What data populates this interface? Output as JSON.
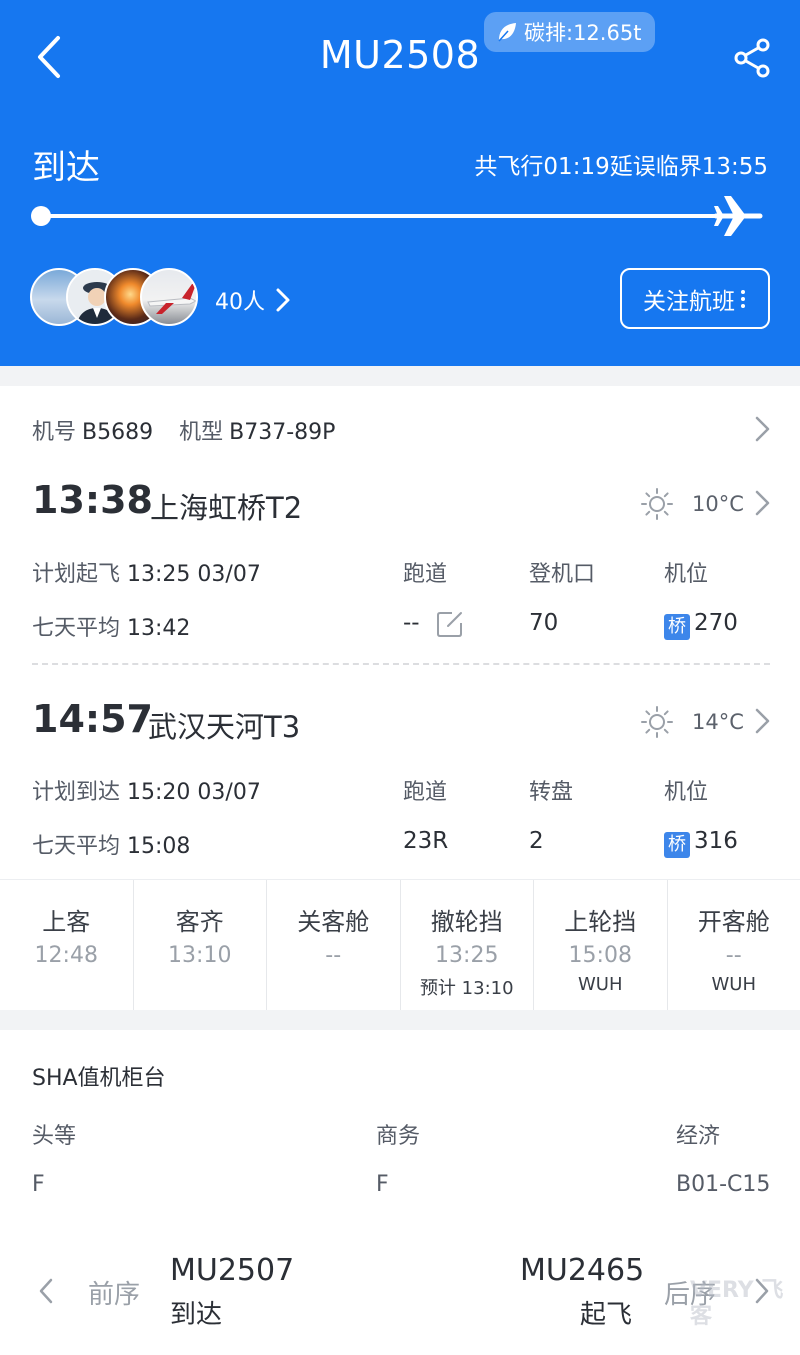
{
  "header": {
    "flight_no": "MU2508",
    "carbon": "碳排:12.65t",
    "status": "到达",
    "flight_time": "共飞行01:19延误临界13:55",
    "people_count": "40人",
    "follow_label": "关注航班",
    "bg_color": "#1677f0"
  },
  "aircraft": {
    "reg_label": "机号",
    "reg_value": "B5689",
    "type_label": "机型",
    "type_value": "B737-89P"
  },
  "departure": {
    "time": "13:38",
    "airport": "上海虹桥T2",
    "temp": "10°C",
    "plan_label": "计划起飞",
    "plan_value": "13:25 03/07",
    "avg_label": "七天平均",
    "avg_value": "13:42",
    "runway_label": "跑道",
    "runway_value": "--",
    "gate_label": "登机口",
    "gate_value": "70",
    "stand_label": "机位",
    "stand_badge": "桥",
    "stand_value": "270"
  },
  "arrival": {
    "time": "14:57",
    "airport": "武汉天河T3",
    "temp": "14°C",
    "plan_label": "计划到达",
    "plan_value": "15:20 03/07",
    "avg_label": "七天平均",
    "avg_value": "15:08",
    "runway_label": "跑道",
    "runway_value": "23R",
    "carousel_label": "转盘",
    "carousel_value": "2",
    "stand_label": "机位",
    "stand_badge": "桥",
    "stand_value": "316"
  },
  "ops": [
    {
      "name": "上客",
      "time": "12:48",
      "sub": ""
    },
    {
      "name": "客齐",
      "time": "13:10",
      "sub": ""
    },
    {
      "name": "关客舱",
      "time": "--",
      "sub": ""
    },
    {
      "name": "撤轮挡",
      "time": "13:25",
      "sub": "预计 13:10"
    },
    {
      "name": "上轮挡",
      "time": "15:08",
      "sub": "WUH"
    },
    {
      "name": "开客舱",
      "time": "--",
      "sub": "WUH"
    }
  ],
  "checkin": {
    "title": "SHA值机柜台",
    "first_label": "头等",
    "first_value": "F",
    "business_label": "商务",
    "business_value": "F",
    "economy_label": "经济",
    "economy_value": "B01-C15"
  },
  "sequence": {
    "prev_label": "前序",
    "prev_flight": "MU2507",
    "prev_status": "到达",
    "next_label": "后序",
    "next_flight": "MU2465",
    "next_status": "起飞"
  },
  "watermark": "VERY 飞客"
}
